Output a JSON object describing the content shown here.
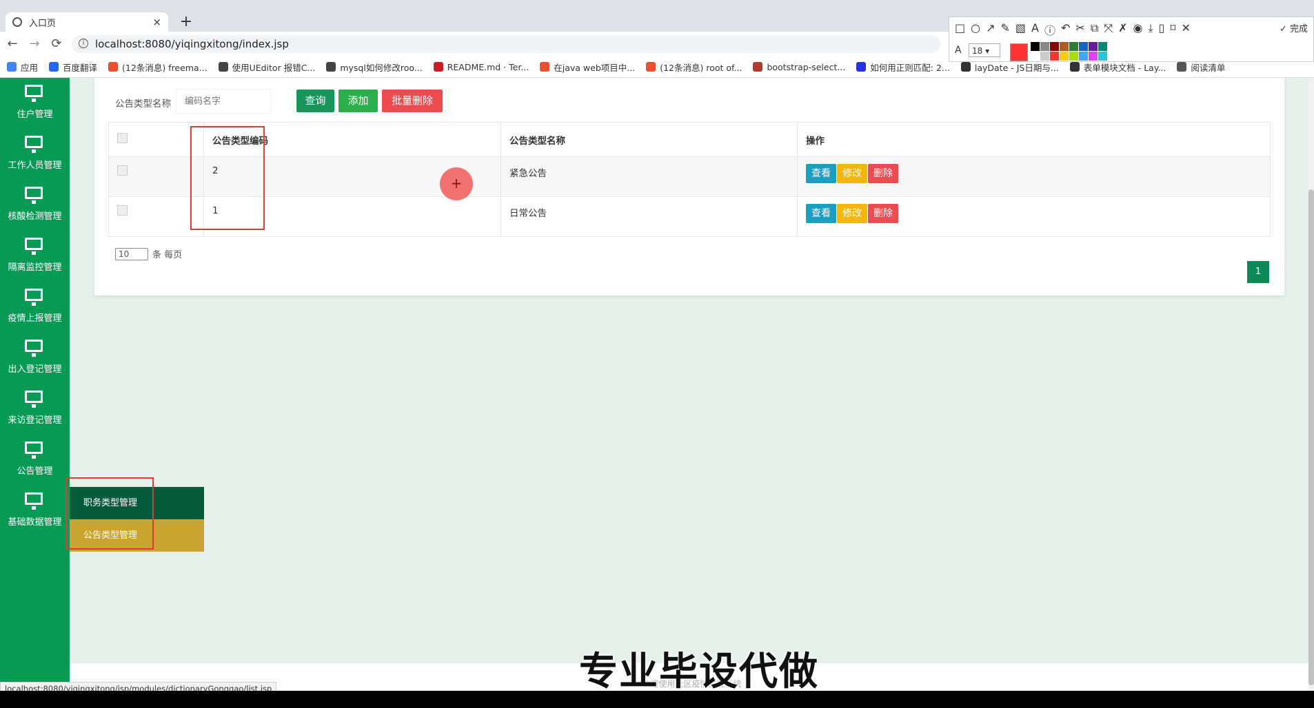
{
  "browser": {
    "tab_title": "入口页",
    "close_glyph": "×",
    "new_tab_glyph": "+",
    "url": "localhost:8080/yiqingxitong/index.jsp",
    "nav": {
      "back": "←",
      "forward": "→",
      "reload": "⟳"
    },
    "bookmarks": [
      {
        "label": "应用",
        "color": "#4285f4"
      },
      {
        "label": "百度翻译",
        "color": "#2468f2"
      },
      {
        "label": "(12条消息) freema...",
        "color": "#e8502f"
      },
      {
        "label": "使用UEditor 报错C...",
        "color": "#444444"
      },
      {
        "label": "mysql如何修改roo...",
        "color": "#444444"
      },
      {
        "label": "README.md · Ter...",
        "color": "#c71d23"
      },
      {
        "label": "在java web项目中...",
        "color": "#e8502f"
      },
      {
        "label": "(12条消息) root of...",
        "color": "#e8502f"
      },
      {
        "label": "bootstrap-select...",
        "color": "#b03a2e"
      },
      {
        "label": "如何用正则匹配: 2...",
        "color": "#2932e1"
      },
      {
        "label": "layDate - JS日期与...",
        "color": "#333333"
      },
      {
        "label": "表单模块文档 - Lay...",
        "color": "#333333"
      },
      {
        "label": "阅读清单",
        "color": "#555555"
      }
    ]
  },
  "snip_tool": {
    "tools": [
      "□",
      "○",
      "↗",
      "✎",
      "▧",
      "A",
      "ⓘ",
      "↶",
      "✂",
      "⧉",
      "⤧",
      "✗",
      "◉",
      "⤓",
      "▯",
      "⌑",
      "✕"
    ],
    "done_label": "✓ 完成",
    "font_glyph": "A",
    "font_size": "18 ▾",
    "current_color": "#ff3333",
    "swatches": [
      "#000000",
      "#888888",
      "#8b0000",
      "#b05a1c",
      "#2e7d32",
      "#1565c0",
      "#6a1b9a",
      "#00897b",
      "#ffffff",
      "#cccccc",
      "#ff3333",
      "#ffcc00",
      "#aadd00",
      "#42a5f5",
      "#e040fb",
      "#26c6da"
    ]
  },
  "sidebar": {
    "items": [
      {
        "label": "住户管理"
      },
      {
        "label": "工作人员管理"
      },
      {
        "label": "核酸检测管理"
      },
      {
        "label": "隔离监控管理"
      },
      {
        "label": "疫情上报管理"
      },
      {
        "label": "出入登记管理"
      },
      {
        "label": "来访登记管理"
      },
      {
        "label": "公告管理"
      },
      {
        "label": "基础数据管理"
      }
    ],
    "submenu": [
      {
        "label": "职务类型管理"
      },
      {
        "label": "公告类型管理"
      }
    ]
  },
  "search": {
    "label": "公告类型名称",
    "placeholder": "编码名字",
    "query_button": "查询",
    "add_button": "添加",
    "batch_delete_button": "批量删除"
  },
  "table": {
    "headers": {
      "code": "公告类型编码",
      "name": "公告类型名称",
      "actions": "操作"
    },
    "rows": [
      {
        "code": "2",
        "name": "紧急公告"
      },
      {
        "code": "1",
        "name": "日常公告"
      }
    ],
    "actions": {
      "view": "查看",
      "edit": "修改",
      "delete": "删除"
    }
  },
  "pagination": {
    "page_size": "10",
    "page_size_suffix": "条 每页",
    "current_page": "1"
  },
  "footer": {
    "text": "欢迎使用社区疫情防控系统"
  },
  "status_url": "localhost:8080/yiqingxitong/jsp/modules/dictionaryGonggao/list.jsp",
  "watermark": "专业毕设代做",
  "colors": {
    "sidebar_green": "#079a55",
    "submenu_dark": "#065c3c",
    "submenu_active": "#c9a431",
    "annotation_red": "#e53935"
  }
}
